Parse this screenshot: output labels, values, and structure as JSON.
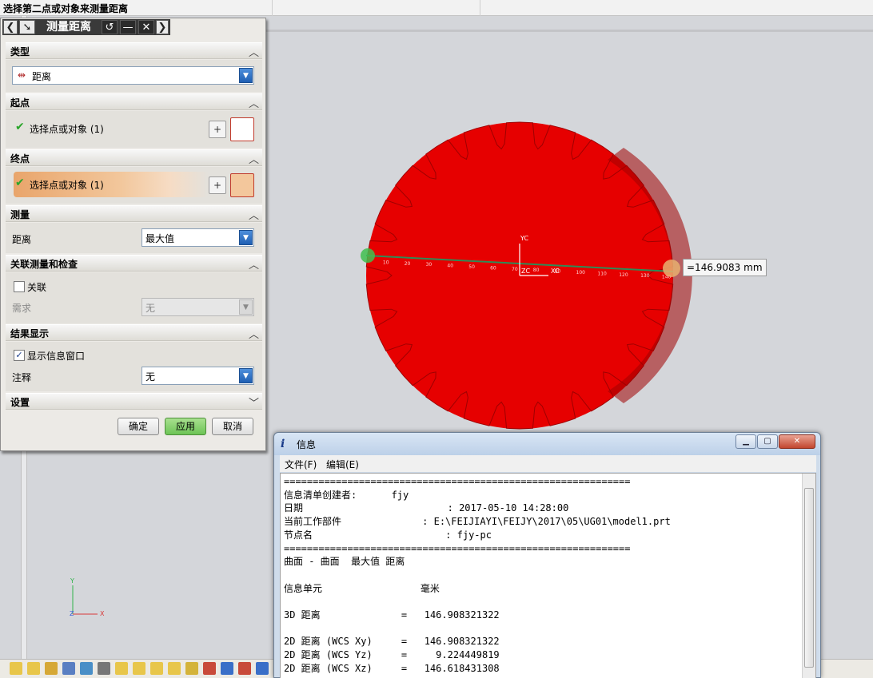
{
  "prompt": "选择第二点或对象来测量距离",
  "dialog": {
    "title": "测量距离",
    "sections": {
      "type": {
        "label": "类型",
        "value": "距离"
      },
      "start": {
        "label": "起点",
        "select_label": "选择点或对象 (1)"
      },
      "end": {
        "label": "终点",
        "select_label": "选择点或对象 (1)"
      },
      "measure": {
        "label": "测量",
        "field_label": "距离",
        "value": "最大值"
      },
      "assoc": {
        "label": "关联测量和检查",
        "checkbox_label": "关联",
        "req_label": "需求",
        "req_value": "无"
      },
      "result": {
        "label": "结果显示",
        "checkbox_label": "显示信息窗口",
        "note_label": "注释",
        "note_value": "无"
      },
      "settings": {
        "label": "设置"
      }
    },
    "buttons": {
      "ok": "确定",
      "apply": "应用",
      "cancel": "取消"
    }
  },
  "graphics": {
    "measure_value": "=146.9083 mm",
    "axis_labels": {
      "yc": "YC",
      "xc": "XC",
      "zc": "ZC"
    },
    "ruler_ticks": [
      "10",
      "20",
      "30",
      "40",
      "50",
      "60",
      "70",
      "80",
      "90",
      "100",
      "110",
      "120",
      "130",
      "140"
    ],
    "triad": {
      "y": "Y",
      "x": "X",
      "z": "Z"
    },
    "gear_color": "#e60000",
    "gear_edge_color": "#9e0000",
    "line_color": "#2e8b57"
  },
  "info": {
    "title": "信息",
    "menu": [
      "文件(F)",
      "编辑(E)"
    ],
    "lines": [
      "============================================================",
      "信息清单创建者:      fjy",
      "日期                         : 2017-05-10 14:28:00",
      "当前工作部件              : E:\\FEIJIAYI\\FEIJY\\2017\\05\\UG01\\model1.prt",
      "节点名                       : fjy-pc",
      "============================================================",
      "曲面 - 曲面  最大值 距离",
      "",
      "信息单元                 毫米",
      "",
      "3D 距离              =   146.908321322",
      "",
      "2D 距离 (WCS Xy)     =   146.908321322",
      "2D 距离 (WCS Yz)     =     9.224449819",
      "2D 距离 (WCS Xz)     =   146.618431308"
    ]
  }
}
